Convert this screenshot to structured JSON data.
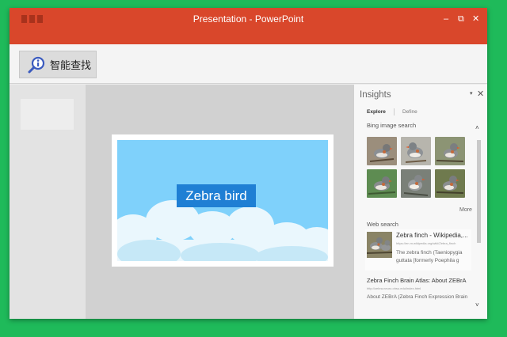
{
  "window": {
    "title": "Presentation - PowerPoint",
    "controls": {
      "minimize": "–",
      "restore": "⧉",
      "close": "✕"
    }
  },
  "ribbon": {
    "smart_lookup_label": "智能查找",
    "smart_lookup_icon": "search-info-icon"
  },
  "slide": {
    "title": "Zebra bird"
  },
  "insights": {
    "title": "Insights",
    "pin": "▾",
    "close": "✕",
    "tabs": {
      "explore": "Explore",
      "define": "Define"
    },
    "bing_image_search": "Bing image search",
    "images": [
      "bird-photo-1",
      "bird-photo-2",
      "bird-photo-3",
      "bird-photo-4",
      "bird-photo-5",
      "bird-photo-6"
    ],
    "more": "More",
    "web_search": "Web search",
    "results": [
      {
        "title": "Zebra finch - Wikipedia,...",
        "url": "https://en.m.wikipedia.org/wiki/Zebra_finch",
        "snippet": "The zebra finch (Taeniopygia guttata [formerly Poephila g"
      },
      {
        "title": "Zebra Finch Brain Atlas: About ZEBrA",
        "url": "http://zebra.neuro.ohsu.edu/index.html",
        "snippet": "About ZEBrA (Zebra Finch Expression Brain"
      }
    ],
    "scroll_up": "˄",
    "scroll_down": "˅"
  },
  "colors": {
    "background": "#1fba5a",
    "titlebar": "#d9472b",
    "slide_sky": "#7fd1fb",
    "title_box": "#1f7fd4"
  }
}
